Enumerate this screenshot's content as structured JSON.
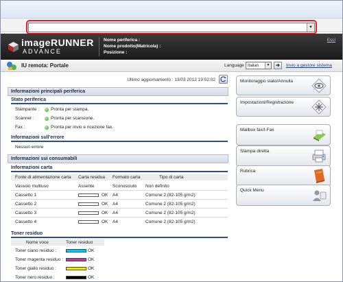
{
  "header": {
    "brand_line1": "imageRUNNER",
    "brand_line2": "ADVANCE",
    "device_name_label": "Nome periferica :",
    "product_name_label": "Nome prodotto(Matricola) :",
    "location_label": "Posizione :",
    "exit_label": "Esci"
  },
  "titlebar": {
    "title": "IU remota: Portale",
    "language_label": "Language",
    "language_value": "Italian",
    "admin_link": "Invio a gestore sistema"
  },
  "status": {
    "last_update": "Ultimo aggiornamento : 13/03 2012 19:02:02",
    "device_info_header": "Informazioni principali periferica",
    "device_status_header": "Stato periferica",
    "devices": [
      {
        "name": "Stampante :",
        "status": "Pronta per stampa."
      },
      {
        "name": "Scanner :",
        "status": "Pronta per scansione."
      },
      {
        "name": "Fax :",
        "status": "Pronta per invio e ricezione fax."
      }
    ],
    "error_header": "Informazioni sull'errore",
    "error_text": "Nessun errore"
  },
  "consumables": {
    "header": "Informazioni sui consumabili",
    "paper_header": "Informazioni carta",
    "paper_columns": [
      "Fonte di alimentazione carta",
      "Carta residua",
      "Formato carta",
      "Tipo di carta"
    ],
    "paper_rows": [
      {
        "source": "Vassoio multiuso",
        "remaining": "Assente",
        "size": "Sconosciuto",
        "type": "Non definito",
        "bar": false
      },
      {
        "source": "Cassetto 1",
        "remaining": "OK",
        "size": "A4",
        "type": "Comune 2 (82-105 g/m2)",
        "bar": true
      },
      {
        "source": "Cassetto 2",
        "remaining": "OK",
        "size": "A4",
        "type": "Comune 2 (82-105 g/m2)",
        "bar": true
      },
      {
        "source": "Cassetto 3",
        "remaining": "OK",
        "size": "A4",
        "type": "Comune 2 (82-105 g/m2)",
        "bar": true
      },
      {
        "source": "Cassetto 4",
        "remaining": "OK",
        "size": "A4",
        "type": "Comune 2 (82-105 g/m2)",
        "bar": true
      }
    ],
    "toner_header": "Toner residuo",
    "toner_columns": [
      "Nome voce",
      "Toner residuo"
    ],
    "toner_rows": [
      {
        "name": "Toner ciano residuo :",
        "value": "OK",
        "color": "#00c8e8"
      },
      {
        "name": "Toner magenta residuo :",
        "value": "OK",
        "color": "#e020c0"
      },
      {
        "name": "Toner giallo residuo :",
        "value": "OK",
        "color": "#f0e800"
      },
      {
        "name": "Toner nero residuo :",
        "value": "OK",
        "color": "#000000"
      }
    ]
  },
  "side_menu": [
    {
      "label": "Monitoraggio stato/Annulla",
      "icon": "eye-icon"
    },
    {
      "label": "Impostazioni/Registrazione",
      "icon": "settings-star-icon"
    },
    {
      "label": "Mailbox fax/I-Fax",
      "icon": "mailbox-icon"
    },
    {
      "label": "Stampa diretta",
      "icon": "printer-icon"
    },
    {
      "label": "Rubrica",
      "icon": "address-book-icon"
    },
    {
      "label": "Quick Menu",
      "icon": "quick-menu-icon"
    }
  ],
  "colors": {
    "header_bg": "#1f1f1f",
    "accent_blue": "#2c4f8c",
    "highlight_red": "#e0202a",
    "status_green": "#2e9e2a"
  }
}
